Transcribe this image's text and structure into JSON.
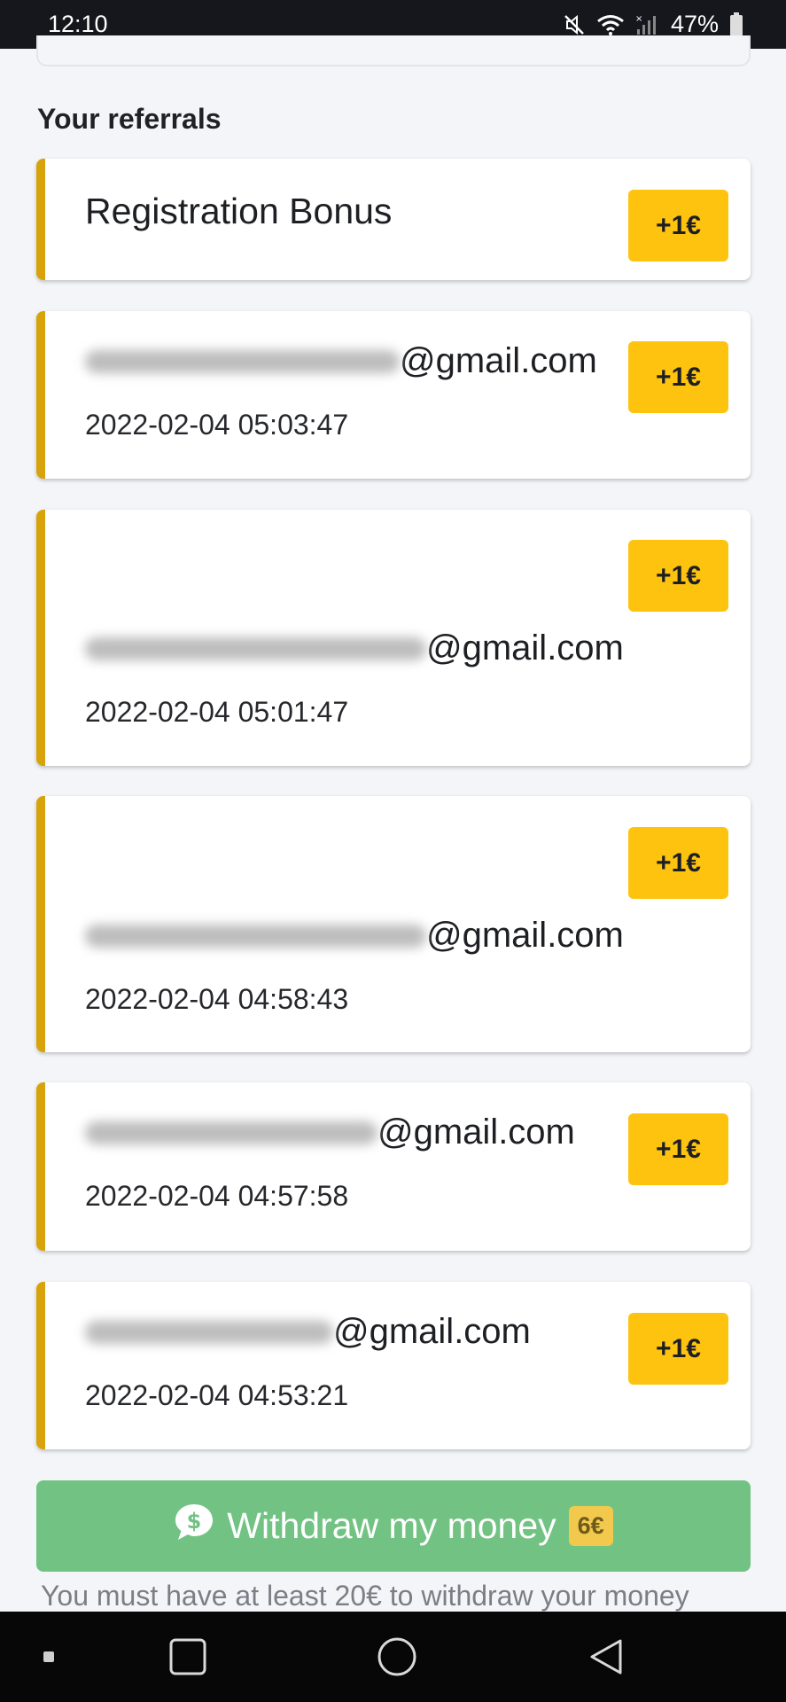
{
  "status_bar": {
    "time": "12:10",
    "battery": "47%",
    "icons": [
      "mute-icon",
      "wifi-icon",
      "signal-icon",
      "battery-icon"
    ]
  },
  "section_title": "Your referrals",
  "registration": {
    "title": "Registration Bonus",
    "badge": "+1€"
  },
  "referrals": [
    {
      "email": "@gmail.com",
      "date": "2022-02-04 05:03:47",
      "badge": "+1€"
    },
    {
      "email": "@gmail.com",
      "date": "2022-02-04 05:01:47",
      "badge": "+1€"
    },
    {
      "email": "@gmail.com",
      "date": "2022-02-04 04:58:43",
      "badge": "+1€"
    },
    {
      "email": "@gmail.com",
      "date": "2022-02-04 04:57:58",
      "badge": "+1€"
    },
    {
      "email": "@gmail.com",
      "date": "2022-02-04 04:53:21",
      "badge": "+1€"
    }
  ],
  "withdraw": {
    "label": "Withdraw my money",
    "amount": "6€",
    "icon": "dollar-chat-icon",
    "note": "You must have at least 20€ to withdraw your money"
  },
  "colors": {
    "accent_border": "#d8a30a",
    "badge_yellow": "#fdc30f",
    "withdraw_green": "#72c383"
  },
  "nav_bar": {
    "icons": [
      "recents-icon",
      "home-icon",
      "back-icon"
    ]
  }
}
